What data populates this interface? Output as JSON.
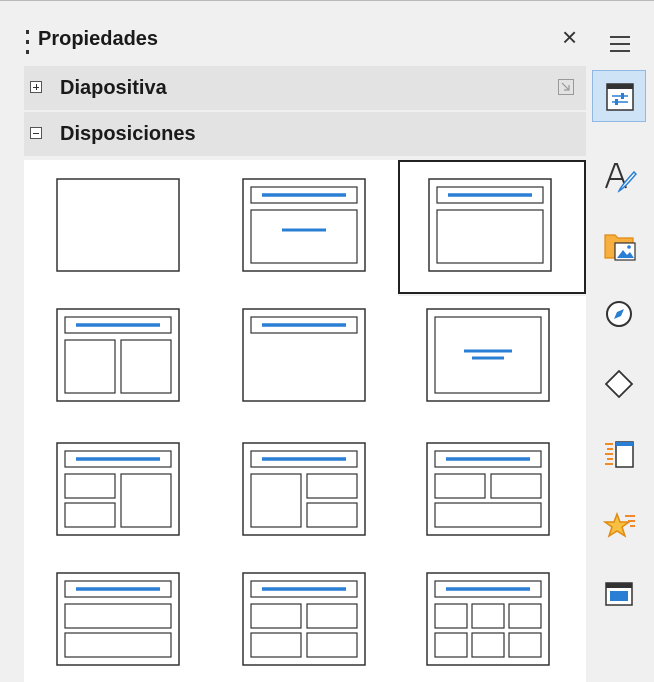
{
  "panel": {
    "title": "Propiedades",
    "close_glyph": "×"
  },
  "sections": [
    {
      "label": "Diapositiva",
      "expanded": false
    },
    {
      "label": "Disposiciones",
      "expanded": true
    }
  ],
  "layouts": {
    "selected_index": 2,
    "items": [
      "blank",
      "title-content-centered",
      "title-content",
      "title-two-columns",
      "title-only",
      "centered-text",
      "title-content-2content",
      "title-2content-content",
      "title-2content-over-content",
      "title-content-over-content",
      "title-4content",
      "title-6content"
    ]
  },
  "deck": {
    "menu_icon": "hamburger-icon",
    "buttons": [
      "properties-icon",
      "styles-icon",
      "gallery-icon",
      "navigator-icon",
      "shapes-icon",
      "slide-transition-icon",
      "animation-icon",
      "master-slides-icon"
    ],
    "active_index": 0
  },
  "colors": {
    "accent": "#2a7fd4",
    "active_bg": "#cfe3f7",
    "panel_bg": "#f0f0f0",
    "section_bg": "#e3e3e3"
  }
}
